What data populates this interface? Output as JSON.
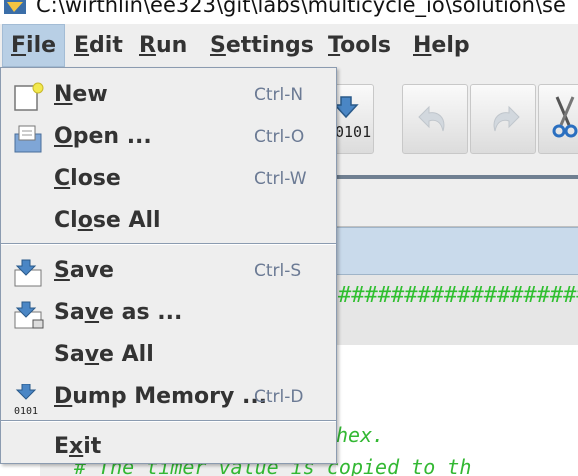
{
  "window": {
    "title": "C:\\wirthlin\\ee323\\git\\labs\\multicycle_io\\solution\\se"
  },
  "menubar": {
    "items": [
      {
        "label": "File",
        "mnemonic": "F",
        "rest": "ile",
        "active": true
      },
      {
        "label": "Edit",
        "mnemonic": "E",
        "rest": "dit"
      },
      {
        "label": "Run",
        "mnemonic": "R",
        "rest": "un"
      },
      {
        "label": "Settings",
        "mnemonic": "S",
        "rest": "ettings"
      },
      {
        "label": "Tools",
        "mnemonic": "T",
        "rest": "ools"
      },
      {
        "label": "Help",
        "mnemonic": "H",
        "rest": "elp"
      }
    ]
  },
  "file_menu": {
    "items": [
      {
        "pre": "",
        "mn": "N",
        "post": "ew",
        "label": "New",
        "accelerator": "Ctrl-N",
        "icon": "new-file-icon"
      },
      {
        "pre": "",
        "mn": "O",
        "post": "pen ...",
        "label": "Open ...",
        "accelerator": "Ctrl-O",
        "icon": "open-file-icon"
      },
      {
        "pre": "",
        "mn": "C",
        "post": "lose",
        "label": "Close",
        "accelerator": "Ctrl-W",
        "icon": ""
      },
      {
        "pre": "Cl",
        "mn": "o",
        "post": "se All",
        "label": "Close All",
        "accelerator": "",
        "icon": ""
      },
      {
        "pre": "",
        "mn": "S",
        "post": "ave",
        "label": "Save",
        "accelerator": "Ctrl-S",
        "icon": "save-icon"
      },
      {
        "pre": "Sa",
        "mn": "v",
        "post": "e as ...",
        "label": "Save as ...",
        "accelerator": "",
        "icon": "save-as-icon"
      },
      {
        "pre": "Sa",
        "mn": "v",
        "post": "e All",
        "label": "Save All",
        "accelerator": "",
        "icon": ""
      },
      {
        "pre": "",
        "mn": "D",
        "post": "ump Memory ...",
        "label": "Dump Memory ...",
        "accelerator": "Ctrl-D",
        "icon": "dump-memory-icon"
      },
      {
        "pre": "E",
        "mn": "x",
        "post": "it",
        "label": "Exit",
        "accelerator": "",
        "icon": ""
      }
    ],
    "dump_icon_caption": "0101"
  },
  "toolbar": {
    "dump_caption": "0101"
  },
  "editor": {
    "hash_line": "####################################",
    "code_line1": "hex.",
    "code_line2": "#   The timer value is copied to th"
  },
  "colors": {
    "menu_highlight": "#b8cfe5",
    "accelerator_text": "#6b7a94",
    "code_comment": "#33b833",
    "band_blue": "#c9daeb"
  }
}
